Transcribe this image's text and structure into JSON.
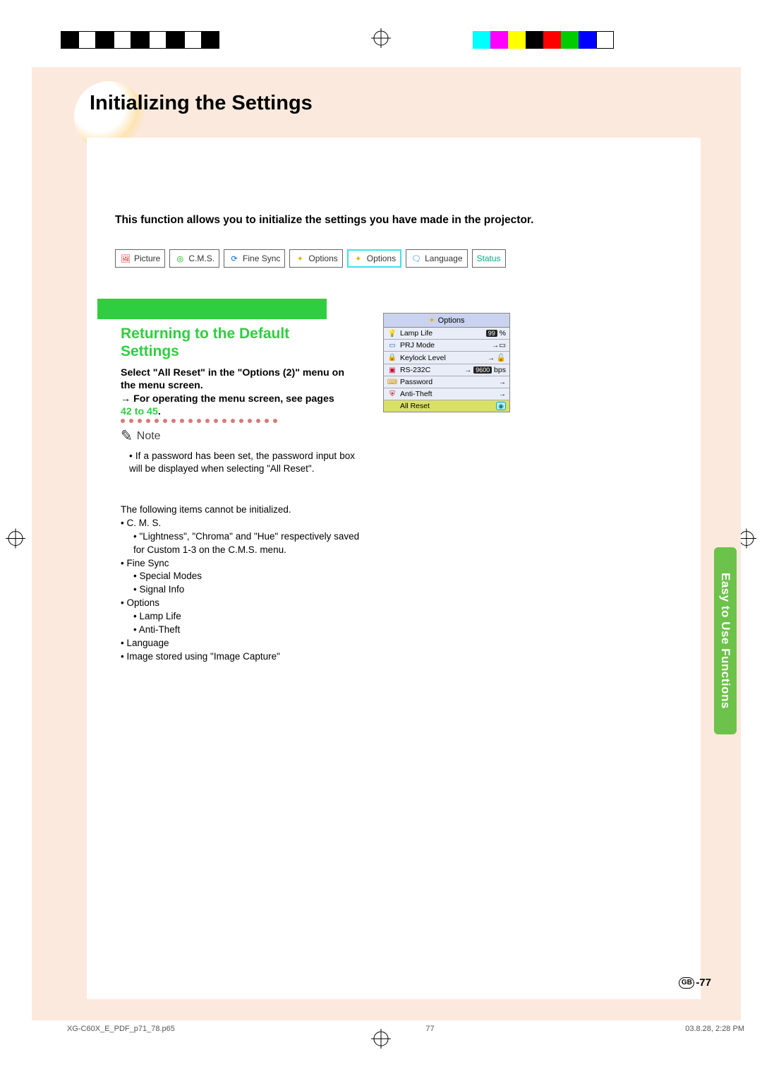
{
  "page_title": "Initializing the Settings",
  "subtitle": "This function allows you to initialize the settings you have made in the projector.",
  "tabs": [
    {
      "label": "Picture",
      "icon": "🖼",
      "fg": "#c00"
    },
    {
      "label": "C.M.S.",
      "icon": "◎",
      "fg": "#0a0"
    },
    {
      "label": "Fine Sync",
      "icon": "⟳",
      "fg": "#06c"
    },
    {
      "label": "Options",
      "icon": "✦",
      "fg": "#e0b000"
    },
    {
      "label": "Options",
      "icon": "✦",
      "fg": "#e0b000",
      "selected": true
    },
    {
      "label": "Language",
      "icon": "🗨",
      "fg": "#06c"
    },
    {
      "label": "Status",
      "icon": "",
      "fg": "#0a8"
    }
  ],
  "section_heading": "Returning to the Default Settings",
  "instruction_bold1": "Select \"All Reset\" in the \"Options (2)\" menu on the menu screen.",
  "instruction_bold2": "→ For operating the menu screen, see pages ",
  "instruction_link": "42 to 45",
  "instruction_period": ".",
  "note_label": "Note",
  "note_body": "If a password has been set, the password input box will be displayed when selecting \"All Reset\".",
  "cannot_intro": "The following items cannot be initialized.",
  "cannot_items": [
    {
      "t": "C. M. S.",
      "subs": [
        "\"Lightness\", \"Chroma\" and \"Hue\" respectively saved for Custom 1-3 on the C.M.S. menu."
      ]
    },
    {
      "t": "Fine Sync",
      "subs": [
        "Special Modes",
        "Signal Info"
      ]
    },
    {
      "t": "Options",
      "subs": [
        "Lamp Life",
        "Anti-Theft"
      ]
    },
    {
      "t": "Language",
      "subs": []
    },
    {
      "t": "Image stored using \"Image Capture\"",
      "subs": []
    }
  ],
  "osd": {
    "title": "Options",
    "rows": [
      {
        "icon": "💡",
        "iconColor": "#d99a00",
        "label": "Lamp Life",
        "right": "<span class='pill'>99</span> %"
      },
      {
        "icon": "▭",
        "iconColor": "#1668c5",
        "label": "PRJ Mode",
        "right": "<span class='arrow'>→</span>▭"
      },
      {
        "icon": "🔒",
        "iconColor": "#d99a00",
        "label": "Keylock Level",
        "right": "<span class='arrow'>→</span> <span style='color:#1a8a1a'>🔓</span>"
      },
      {
        "icon": "▣",
        "iconColor": "#c03",
        "label": "RS-232C",
        "right": "<span class='arrow'>→</span> <span class='pill'>9600</span> bps"
      },
      {
        "icon": "⌨",
        "iconColor": "#d99a00",
        "label": "Password",
        "right": "<span class='arrow'>→</span>"
      },
      {
        "icon": "⛨",
        "iconColor": "#b00",
        "label": "Anti-Theft",
        "right": "<span class='arrow'>→</span>"
      },
      {
        "icon": "",
        "iconColor": "",
        "label": "All Reset",
        "right": "<span style='display:inline-block;width:14px;height:12px;border:1px solid #1aa;border-radius:3px;background:#bef;color:#077;font-size:9px;line-height:11px;text-align:center;'>◉</span>",
        "sel": true
      }
    ]
  },
  "side_tab": "Easy to Use Functions",
  "page_num_label": "GB",
  "page_num": "-77",
  "footer": {
    "left": "XG-C60X_E_PDF_p71_78.p65",
    "mid": "77",
    "right": "03.8.28, 2:28 PM"
  }
}
